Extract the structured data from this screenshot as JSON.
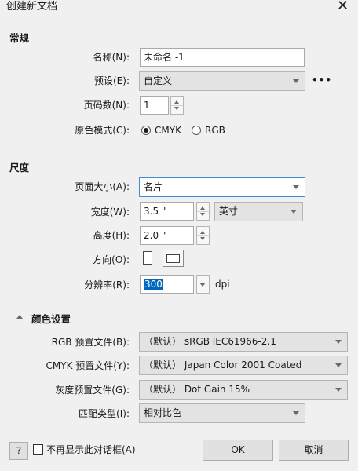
{
  "window": {
    "title": "创建新文档"
  },
  "general": {
    "heading": "常规",
    "name_label": "名称(N):",
    "name_value": "未命名 -1",
    "preset_label": "预设(E):",
    "preset_value": "自定义",
    "more_label": "•••",
    "pages_label": "页码数(N):",
    "pages_value": "1",
    "color_mode_label": "原色模式(C):",
    "color_mode_options": [
      "CMYK",
      "RGB"
    ],
    "color_mode_selected": "CMYK"
  },
  "dimensions": {
    "heading": "尺度",
    "page_size_label": "页面大小(A):",
    "page_size_value": "名片",
    "width_label": "宽度(W):",
    "width_value": "3.5 \"",
    "unit_value": "英寸",
    "height_label": "高度(H):",
    "height_value": "2.0 \"",
    "orientation_label": "方向(O):",
    "resolution_label": "分辨率(R):",
    "resolution_value": "300",
    "resolution_unit": "dpi"
  },
  "color_settings": {
    "heading": "颜色设置",
    "rgb_label": "RGB 预置文件(B):",
    "rgb_value": "（默认） sRGB IEC61966-2.1",
    "cmyk_label": "CMYK 预置文件(Y):",
    "cmyk_value": "（默认） Japan Color 2001 Coated",
    "gray_label": "灰度预置文件(G):",
    "gray_value": "（默认） Dot Gain 15%",
    "match_label": "匹配类型(I):",
    "match_value": "相对比色"
  },
  "footer": {
    "help_label": "?",
    "dont_show_label": "不再显示此对话框(A)",
    "ok_label": "OK",
    "cancel_label": "取消"
  }
}
